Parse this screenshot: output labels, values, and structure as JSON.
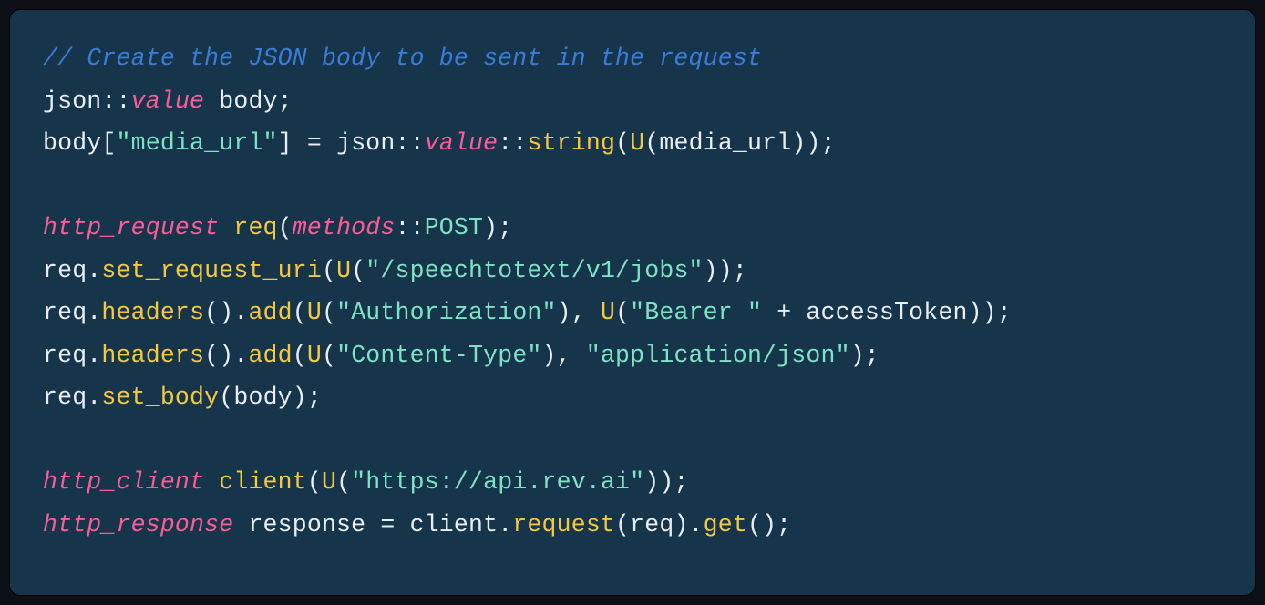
{
  "code": {
    "line1": {
      "comment": "// Create the JSON body to be sent in the request"
    },
    "line2": {
      "ns": "json",
      "sep": "::",
      "type": "value",
      "var": " body;"
    },
    "line3": {
      "obj": "body[",
      "key": "\"media_url\"",
      "close": "] ",
      "eq": "=",
      "sp": " ",
      "ns": "json",
      "sep1": "::",
      "type": "value",
      "sep2": "::",
      "fn": "string",
      "open": "(",
      "ufn": "U",
      "uopen": "(",
      "arg": "media_url",
      "uclose": ")",
      "pclose": ");"
    },
    "line5": {
      "type": "http_request",
      "sp": " ",
      "fn": "req",
      "open": "(",
      "mtype": "methods",
      "sep": "::",
      "post": "POST",
      "close": ");"
    },
    "line6": {
      "obj": "req.",
      "fn": "set_request_uri",
      "open": "(",
      "ufn": "U",
      "uopen": "(",
      "str": "\"/speechtotext/v1/jobs\"",
      "uclose": ")",
      "close": ");"
    },
    "line7": {
      "obj": "req.",
      "fn1": "headers",
      "p1": "().",
      "fn2": "add",
      "open": "(",
      "ufn1": "U",
      "u1open": "(",
      "str1": "\"Authorization\"",
      "u1close": "), ",
      "ufn2": "U",
      "u2open": "(",
      "str2": "\"Bearer \"",
      "plus": " + ",
      "var": "accessToken",
      "u2close": ")",
      "close": ");"
    },
    "line8": {
      "obj": "req.",
      "fn1": "headers",
      "p1": "().",
      "fn2": "add",
      "open": "(",
      "ufn": "U",
      "uopen": "(",
      "str1": "\"Content-Type\"",
      "uclose": "), ",
      "str2": "\"application/json\"",
      "close": ");"
    },
    "line9": {
      "obj": "req.",
      "fn": "set_body",
      "open": "(",
      "arg": "body",
      "close": ");"
    },
    "line11": {
      "type": "http_client",
      "sp": " ",
      "fn": "client",
      "open": "(",
      "ufn": "U",
      "uopen": "(",
      "str": "\"https://api.rev.ai\"",
      "uclose": ")",
      "close": ");"
    },
    "line12": {
      "type": "http_response",
      "sp": " response ",
      "eq": "=",
      "sp2": " client.",
      "fn1": "request",
      "p1": "(req).",
      "fn2": "get",
      "close": "();"
    }
  }
}
